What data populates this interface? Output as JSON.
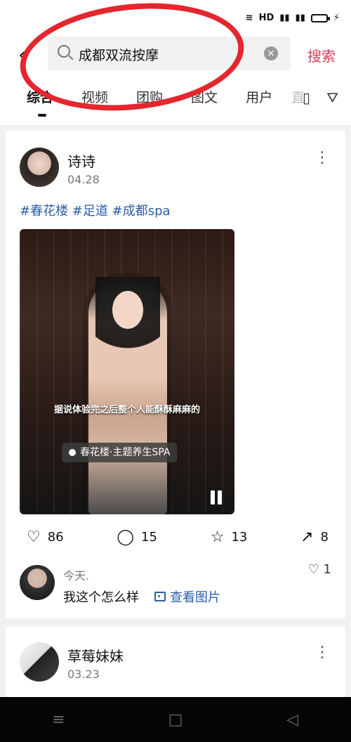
{
  "status_bar": {
    "icons": [
      "wifi",
      "hd",
      "4g",
      "4g",
      "battery",
      "charging"
    ]
  },
  "header": {
    "back_icon": "back-arrow",
    "query": "成都双流按摩",
    "clear_icon": "clear-circle-x",
    "search_button": "搜索",
    "tabs": [
      "综合",
      "视频",
      "团购",
      "图文",
      "用户"
    ],
    "active_tab_index": 0,
    "fade_text": "直"
  },
  "post1": {
    "author": "诗诗",
    "date": "04.28",
    "tags": "#春花楼 #足道 #成都spa",
    "video_text": "据说体验完之后整个人能酥酥麻麻的",
    "location": "春花楼·主题养生SPA",
    "likes": "86",
    "comments": "15",
    "favorites": "13",
    "shares": "8",
    "comment_time": "今天.",
    "comment_text": "我这个怎么样",
    "view_pic": "查看图片",
    "comment_likes": "1"
  },
  "post2": {
    "author": "草莓妹妹",
    "date": "03.23"
  }
}
